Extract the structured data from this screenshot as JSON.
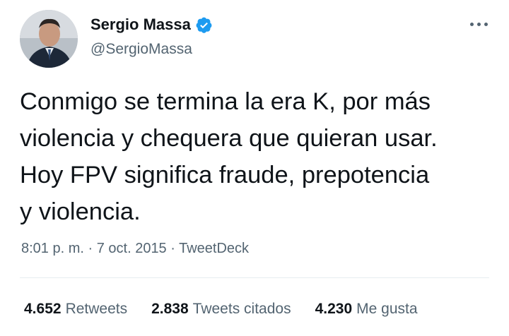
{
  "author": {
    "name": "Sergio Massa",
    "handle": "@SergioMassa",
    "verified_color": "#1d9bf0"
  },
  "tweet": {
    "lines": [
      "Conmigo se termina la era K, por más",
      "violencia y chequera que quieran usar.",
      "Hoy FPV significa fraude, prepotencia",
      "y violencia."
    ],
    "time": "8:01 p. m.",
    "separator": "·",
    "date": "7 oct. 2015",
    "source": "TweetDeck"
  },
  "stats": {
    "retweets_count": "4.652",
    "retweets_label": "Retweets",
    "quotes_count": "2.838",
    "quotes_label": "Tweets citados",
    "likes_count": "4.230",
    "likes_label": "Me gusta"
  },
  "icons": {
    "more": "more-options-icon",
    "verified": "verified-badge-icon"
  }
}
